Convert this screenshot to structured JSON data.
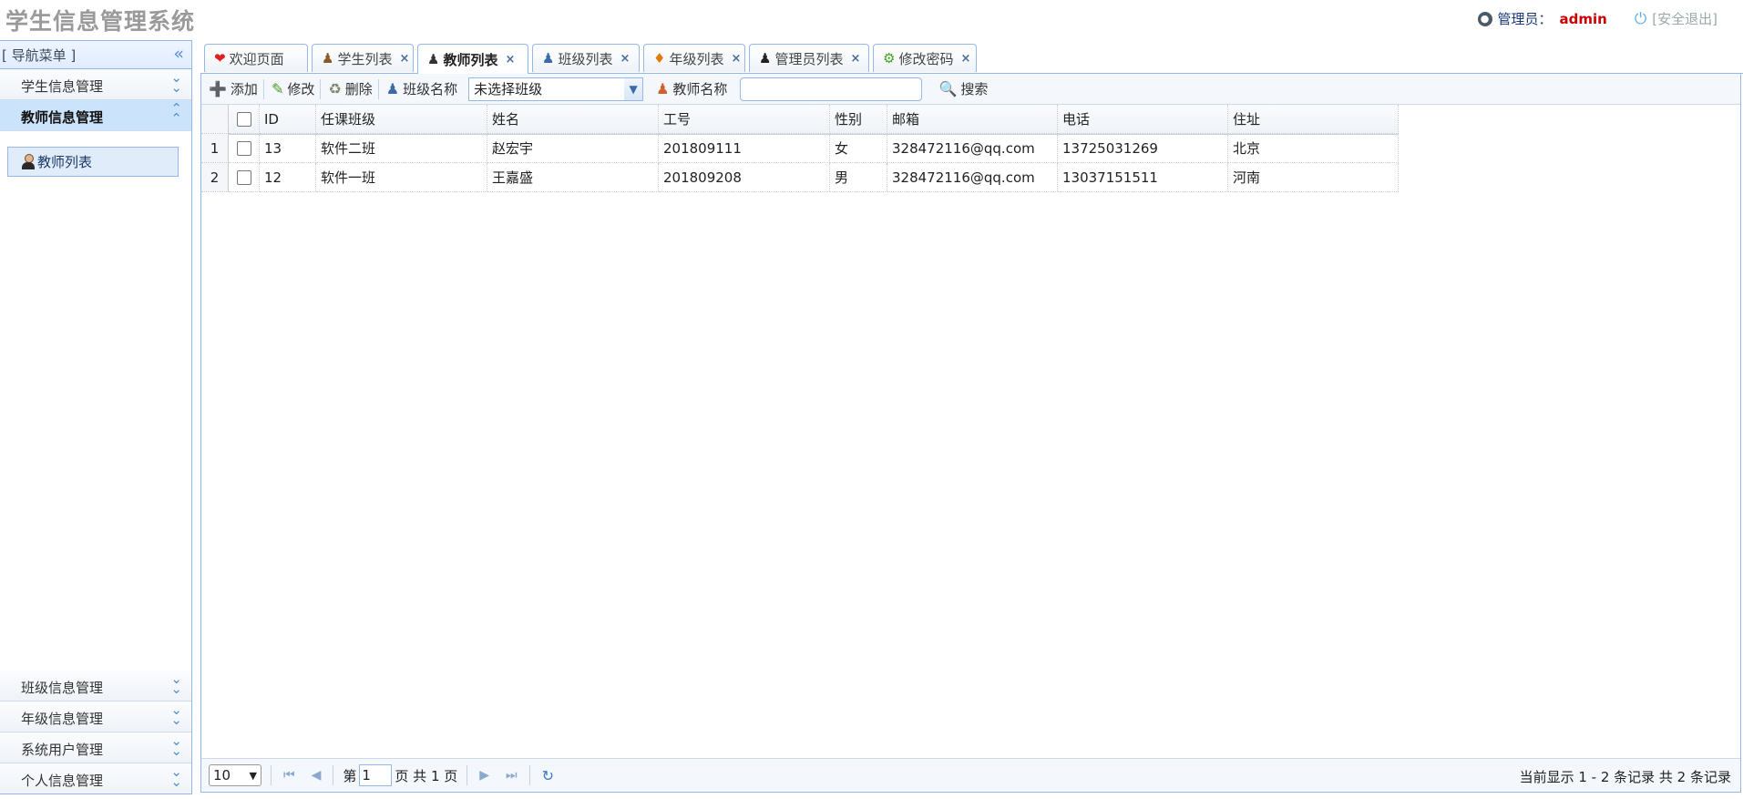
{
  "app": {
    "title": "学生信息管理系统",
    "admin_label": "管理员：",
    "admin_name": "admin",
    "logout": "[安全退出]"
  },
  "sidebar": {
    "title": "[ 导航菜单 ]",
    "groups": [
      {
        "label": "学生信息管理"
      },
      {
        "label": "教师信息管理"
      },
      {
        "label": "班级信息管理"
      },
      {
        "label": "年级信息管理"
      },
      {
        "label": "系统用户管理"
      },
      {
        "label": "个人信息管理"
      }
    ],
    "active_leaf": "教师列表"
  },
  "tabs": [
    {
      "label": "欢迎页面",
      "icon": "heart-icon"
    },
    {
      "label": "学生列表",
      "icon": "student-icon"
    },
    {
      "label": "教师列表",
      "icon": "teacher-icon"
    },
    {
      "label": "班级列表",
      "icon": "class-icon"
    },
    {
      "label": "年级列表",
      "icon": "tag-icon"
    },
    {
      "label": "管理员列表",
      "icon": "admin-icon"
    },
    {
      "label": "修改密码",
      "icon": "gear-icon"
    }
  ],
  "toolbar": {
    "add": "添加",
    "edit": "修改",
    "delete": "删除",
    "class_label": "班级名称",
    "class_value": "未选择班级",
    "teacher_label": "教师名称",
    "search": "搜索"
  },
  "table": {
    "headers": [
      "ID",
      "任课班级",
      "姓名",
      "工号",
      "性别",
      "邮箱",
      "电话",
      "住址"
    ],
    "rows": [
      {
        "n": "1",
        "id": "13",
        "cls": "软件二班",
        "name": "赵宏宇",
        "no": "201809111",
        "sex": "女",
        "email": "328472116@qq.com",
        "phone": "13725031269",
        "addr": "北京"
      },
      {
        "n": "2",
        "id": "12",
        "cls": "软件一班",
        "name": "王嘉盛",
        "no": "201809208",
        "sex": "男",
        "email": "328472116@qq.com",
        "phone": "13037151511",
        "addr": "河南"
      }
    ]
  },
  "pager": {
    "page_size": "10",
    "page_prefix": "第",
    "page": "1",
    "page_suffix": "页 共 1 页",
    "info": "当前显示 1 - 2 条记录 共 2 条记录"
  }
}
